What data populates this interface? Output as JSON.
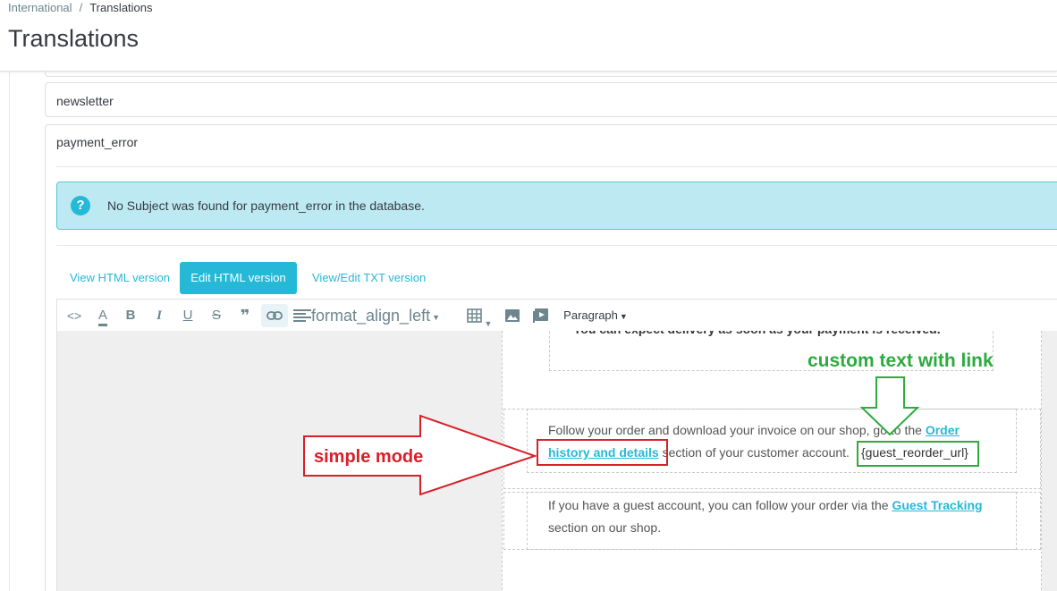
{
  "breadcrumb": {
    "parent": "International",
    "separator": "/",
    "current": "Translations"
  },
  "page": {
    "title": "Translations"
  },
  "rows": {
    "newsletter": "newsletter",
    "payment_error": "payment_error"
  },
  "alert": {
    "icon": "question-icon",
    "icon_glyph": "?",
    "text": "No Subject was found for payment_error in the database."
  },
  "tabs": [
    {
      "label": "View HTML version",
      "active": false
    },
    {
      "label": "Edit HTML version",
      "active": true
    },
    {
      "label": "View/Edit TXT version",
      "active": false
    }
  ],
  "toolbar": {
    "code": "<>",
    "text_color": "A",
    "bold": "B",
    "italic": "I",
    "underline": "U",
    "strikethrough": "S",
    "blockquote": "❞",
    "align_label": "format_align_left",
    "paragraph": "Paragraph",
    "icons": [
      "code-icon",
      "text-color-icon",
      "bold-icon",
      "italic-icon",
      "underline-icon",
      "strikethrough-icon",
      "quote-icon",
      "link-icon",
      "align-icon",
      "table-icon",
      "image-icon",
      "video-icon"
    ]
  },
  "email": {
    "cut_line": "You can expect delivery as soon as your payment is received.",
    "follow_text_1": "Follow your order and download your invoice on our shop, go to the",
    "follow_link_1": "Order",
    "follow_link_2": "history and details",
    "follow_text_2": "section of your customer account.",
    "guest_placeholder": "{guest_reorder_url}",
    "guest_text_1": "If you have a guest account, you can follow your order via the",
    "guest_link": "Guest Tracking",
    "guest_text_2": "section on our shop."
  },
  "annotations": {
    "custom_text": "custom text with link",
    "simple_mode": "simple mode"
  },
  "colors": {
    "accent": "#25b9d7",
    "alert_bg": "#bdeaf2",
    "annotation_green": "#2eaa3f",
    "annotation_red": "#d7202a"
  }
}
